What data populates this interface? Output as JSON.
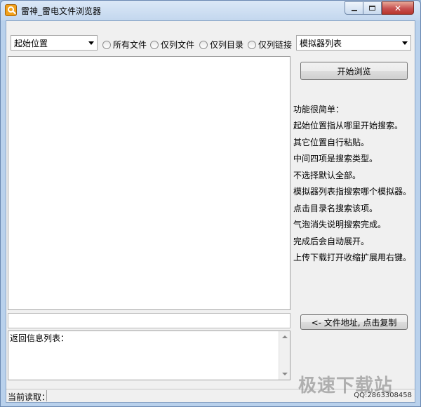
{
  "window": {
    "title": "雷神_雷电文件浏览器"
  },
  "toolbar": {
    "start_location": "起始位置",
    "radios": [
      {
        "label": "所有文件"
      },
      {
        "label": "仅列文件"
      },
      {
        "label": "仅列目录"
      },
      {
        "label": "仅列链接"
      }
    ],
    "emulator_list": "模拟器列表"
  },
  "buttons": {
    "start_browse": "开始浏览",
    "copy_path": "<-  文件地址, 点击复制"
  },
  "help": {
    "lines": [
      "功能很简单：",
      "起始位置指从哪里开始搜索。",
      "其它位置自行粘贴。",
      "中间四项是搜索类型。",
      "不选择默认全部。",
      "模拟器列表指搜索哪个模拟器。",
      "点击目录名搜索该项。",
      "气泡消失说明搜索完成。",
      "完成后会自动展开。",
      "上传下载打开收缩扩展用右键。"
    ]
  },
  "info": {
    "label": "返回信息列表："
  },
  "status": {
    "current_label": "当前读取：",
    "qq": "QQ:2863308458"
  },
  "watermark": "极速下载站",
  "icons": {
    "app": "magnifier-icon",
    "minimize": "minimize-icon",
    "maximize": "maximize-icon",
    "close": "close-icon"
  }
}
